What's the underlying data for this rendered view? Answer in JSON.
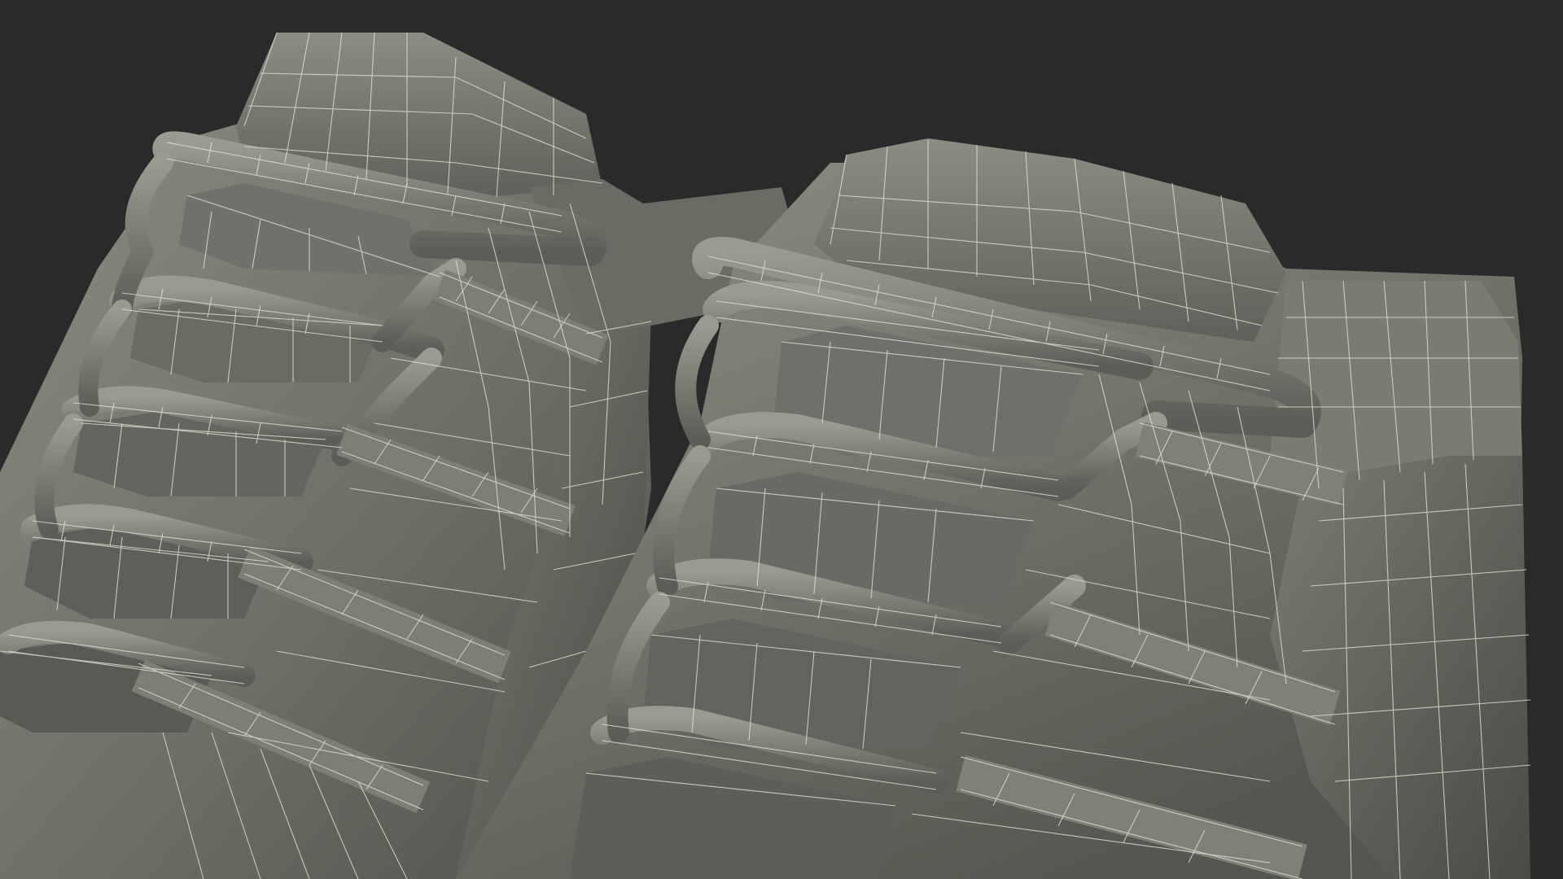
{
  "scene": {
    "subject": "boots-wireframe-render",
    "colors": {
      "background": "#2a2a2a",
      "surface_light": "#8a8b80",
      "surface_mid": "#6e6f66",
      "surface_dark": "#4c4d47",
      "wire": "#e4e4d6"
    }
  }
}
